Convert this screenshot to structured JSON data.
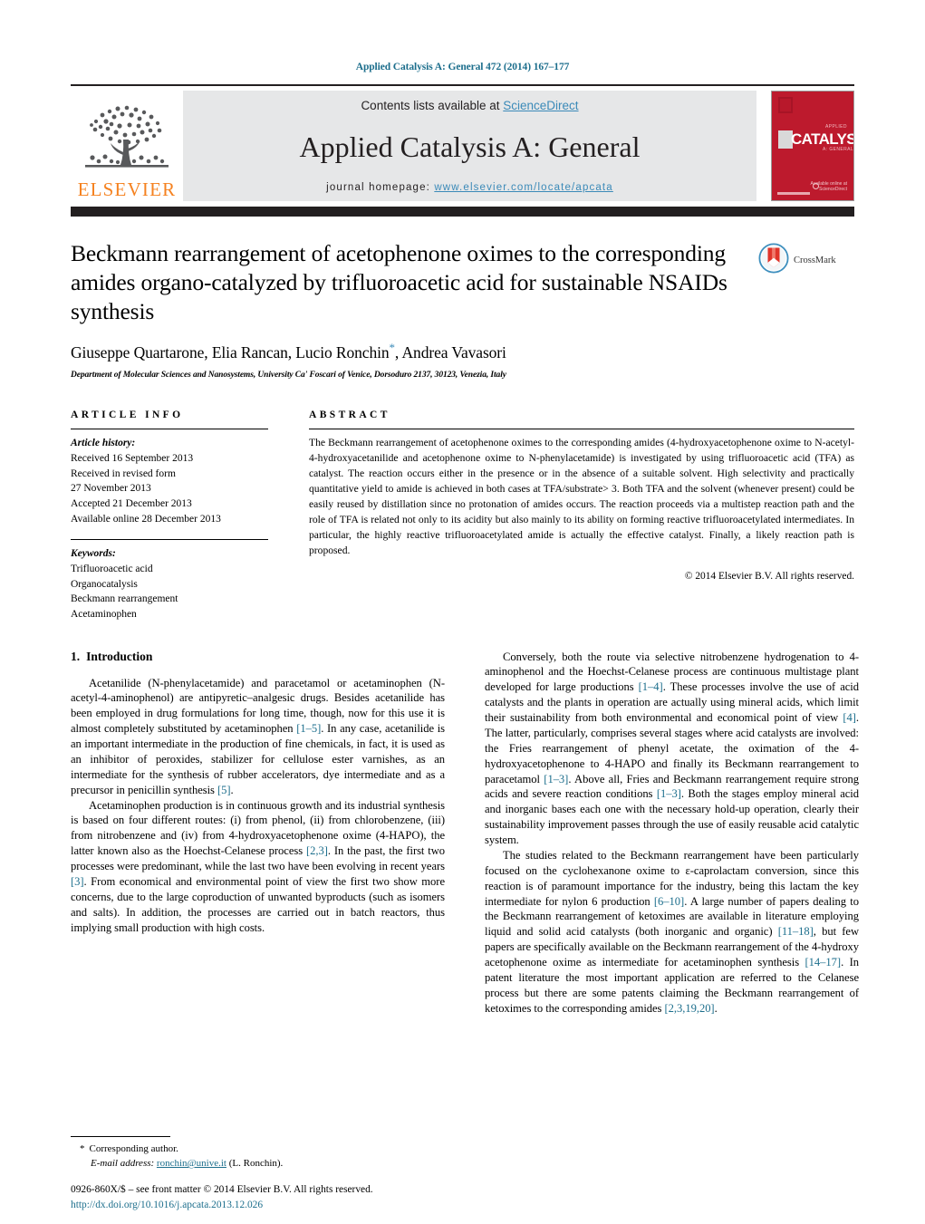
{
  "running_head": "Applied Catalysis A: General 472 (2014) 167–177",
  "masthead": {
    "publisher_logo_name": "elsevier-tree-logo",
    "publisher_wordmark": "ELSEVIER",
    "contents_prefix": "Contents lists available at ",
    "contents_link": "ScienceDirect",
    "journal_title": "Applied Catalysis A: General",
    "homepage_prefix": "journal homepage: ",
    "homepage_url": "www.elsevier.com/locate/apcata",
    "cover": {
      "brand": "CATALYSIS",
      "top_label": "APPLIED",
      "bottom_label": "A: GENERAL",
      "footer_note": "Available online at\nScienceDirect"
    },
    "accent_color": "#3b8ab8",
    "brand_orange": "#f58220",
    "cover_red": "#bd1a2d"
  },
  "title": "Beckmann rearrangement of acetophenone oximes to the corresponding amides organo-catalyzed by trifluoroacetic acid for sustainable NSAIDs synthesis",
  "authors_pre": "Giuseppe Quartarone, Elia Rancan, Lucio Ronchin",
  "authors_post": ", Andrea Vavasori",
  "corresponding_marker": "*",
  "affiliation": "Department of Molecular Sciences and Nanosystems, University Ca' Foscari of Venice, Dorsoduro 2137, 30123, Venezia, Italy",
  "crossmark": {
    "label": "CrossMark",
    "icon": "crossmark-icon"
  },
  "article_info": {
    "heading": "ARTICLE INFO",
    "history_label": "Article history:",
    "history": [
      "Received 16 September 2013",
      "Received in revised form",
      "27 November 2013",
      "Accepted 21 December 2013",
      "Available online 28 December 2013"
    ],
    "keywords_label": "Keywords:",
    "keywords": [
      "Trifluoroacetic acid",
      "Organocatalysis",
      "Beckmann rearrangement",
      "Acetaminophen"
    ]
  },
  "abstract": {
    "heading": "ABSTRACT",
    "text": "The Beckmann rearrangement of acetophenone oximes to the corresponding amides (4-hydroxyacetophenone oxime to N-acetyl-4-hydroxyacetanilide and acetophenone oxime to N-phenylacetamide) is investigated by using trifluoroacetic acid (TFA) as catalyst. The reaction occurs either in the presence or in the absence of a suitable solvent. High selectivity and practically quantitative yield to amide is achieved in both cases at TFA/substrate> 3. Both TFA and the solvent (whenever present) could be easily reused by distillation since no protonation of amides occurs. The reaction proceeds via a multistep reaction path and the role of TFA is related not only to its acidity but also mainly to its ability on forming reactive trifluoroacetylated intermediates. In particular, the highly reactive trifluoroacetylated amide is actually the effective catalyst. Finally, a likely reaction path is proposed.",
    "copyright": "© 2014 Elsevier B.V. All rights reserved."
  },
  "sections": {
    "intro_number": "1.",
    "intro_title": "Introduction"
  },
  "left_column_paragraphs": [
    "Acetanilide (N-phenylacetamide) and paracetamol or acetaminophen (N-acetyl-4-aminophenol) are antipyretic–analgesic drugs. Besides acetanilide has been employed in drug formulations for long time, though, now for this use it is almost completely substituted by acetaminophen [1–5]. In any case, acetanilide is an important intermediate in the production of fine chemicals, in fact, it is used as an inhibitor of peroxides, stabilizer for cellulose ester varnishes, as an intermediate for the synthesis of rubber accelerators, dye intermediate and as a precursor in penicillin synthesis [5].",
    "Acetaminophen production is in continuous growth and its industrial synthesis is based on four different routes: (i) from phenol, (ii) from chlorobenzene, (iii) from nitrobenzene and (iv) from 4-hydroxyacetophenone oxime (4-HAPO), the latter known also as the Hoechst-Celanese process [2,3]. In the past, the first two processes were predominant, while the last two have been evolving in recent years [3]. From economical and environmental point of view the first two show more concerns, due to the large coproduction of unwanted byproducts (such as isomers and salts). In addition, the processes are carried out in batch reactors, thus implying small production with high costs."
  ],
  "right_column_paragraphs": [
    "Conversely, both the route via selective nitrobenzene hydrogenation to 4-aminophenol and the Hoechst-Celanese process are continuous multistage plant developed for large productions [1–4]. These processes involve the use of acid catalysts and the plants in operation are actually using mineral acids, which limit their sustainability from both environmental and economical point of view [4]. The latter, particularly, comprises several stages where acid catalysts are involved: the Fries rearrangement of phenyl acetate, the oximation of the 4-hydroxyacetophenone to 4-HAPO and finally its Beckmann rearrangement to paracetamol [1–3]. Above all, Fries and Beckmann rearrangement require strong acids and severe reaction conditions [1–3]. Both the stages employ mineral acid and inorganic bases each one with the necessary hold-up operation, clearly their sustainability improvement passes through the use of easily reusable acid catalytic system.",
    "The studies related to the Beckmann rearrangement have been particularly focused on the cyclohexanone oxime to ε-caprolactam conversion, since this reaction is of paramount importance for the industry, being this lactam the key intermediate for nylon 6 production [6–10]. A large number of papers dealing to the Beckmann rearrangement of ketoximes are available in literature employing liquid and solid acid catalysts (both inorganic and organic) [11–18], but few papers are specifically available on the Beckmann rearrangement of the 4-hydroxy acetophenone oxime as intermediate for acetaminophen synthesis [14–17]. In patent literature the most important application are referred to the Celanese process but there are some patents claiming the Beckmann rearrangement of ketoximes to the corresponding amides [2,3,19,20]."
  ],
  "footnotes": {
    "corresponding_star": "*",
    "corresponding_text": "Corresponding author.",
    "email_label": "E-mail address:",
    "email": "ronchin@unive.it",
    "email_owner": "(L. Ronchin).",
    "issn_line": "0926-860X/$ – see front matter © 2014 Elsevier B.V. All rights reserved.",
    "doi": "http://dx.doi.org/10.1016/j.apcata.2013.12.026"
  }
}
